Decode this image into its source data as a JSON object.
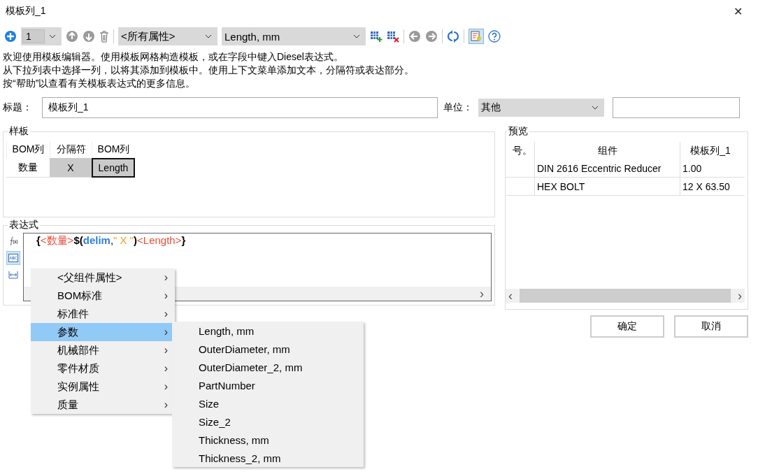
{
  "window": {
    "title": "模板列_1",
    "close": "✕"
  },
  "toolbar": {
    "count_value": "1",
    "property_filter": "<所有属性>",
    "column_select": "Length, mm",
    "toggle_on": true
  },
  "intro": [
    "欢迎使用模板编辑器。使用模板网格构造模板，或在字段中键入Diesel表达式。",
    "从下拉列表中选择一列，以将其添加到模板中。使用上下文菜单添加文本，分隔符或表达部分。",
    "按“帮助”以查看有关模板表达式的更多信息。"
  ],
  "title_row": {
    "label": "标题：",
    "value": "模板列_1",
    "unit_label": "单位：",
    "unit_value": "其他"
  },
  "template": {
    "legend": "样板",
    "cells": [
      {
        "header": "BOM列",
        "value": "数量",
        "shaded": false,
        "selected": false
      },
      {
        "header": "分隔符",
        "value": "X",
        "shaded": true,
        "selected": false
      },
      {
        "header": "BOM列",
        "value": "Length",
        "shaded": true,
        "selected": true
      }
    ]
  },
  "expression": {
    "legend": "表达式",
    "side_buttons": [
      {
        "kind": "function",
        "selected": false
      },
      {
        "kind": "text",
        "selected": true
      },
      {
        "kind": "delimiter",
        "selected": false
      }
    ],
    "segments": [
      {
        "kind": "bracket",
        "text": "{"
      },
      {
        "kind": "field",
        "text": "<数量>"
      },
      {
        "kind": "bracket",
        "text": "$("
      },
      {
        "kind": "keyword",
        "text": "delim"
      },
      {
        "kind": "plain",
        "text": ","
      },
      {
        "kind": "string",
        "text": "\" X \""
      },
      {
        "kind": "bracket",
        "text": ")"
      },
      {
        "kind": "field",
        "text": "<Length>"
      },
      {
        "kind": "bracket",
        "text": "}"
      }
    ],
    "scroll_arrow": "›"
  },
  "preview": {
    "legend": "预览",
    "columns": [
      "号。",
      "组件",
      "模板列_1"
    ],
    "rows": [
      [
        "",
        "DIN 2616 Eccentric Reducer",
        "1.00"
      ],
      [
        "",
        "HEX BOLT",
        "12 X 63.50"
      ]
    ],
    "scroll_left": "‹",
    "scroll_right": "›"
  },
  "buttons": [
    "确定",
    "取消"
  ],
  "context_menu": {
    "items": [
      {
        "label": "<父组件属性>",
        "selected": false
      },
      {
        "label": "BOM标准",
        "selected": false
      },
      {
        "label": "标准件",
        "selected": false
      },
      {
        "label": "参数",
        "selected": true
      },
      {
        "label": "机械部件",
        "selected": false
      },
      {
        "label": "零件材质",
        "selected": false
      },
      {
        "label": "实例属性",
        "selected": false
      },
      {
        "label": "质量",
        "selected": false
      }
    ],
    "arrow": "›",
    "submenu": [
      "Length, mm",
      "OuterDiameter, mm",
      "OuterDiameter_2, mm",
      "PartNumber",
      "Size",
      "Size_2",
      "Thickness, mm",
      "Thickness_2, mm"
    ]
  }
}
